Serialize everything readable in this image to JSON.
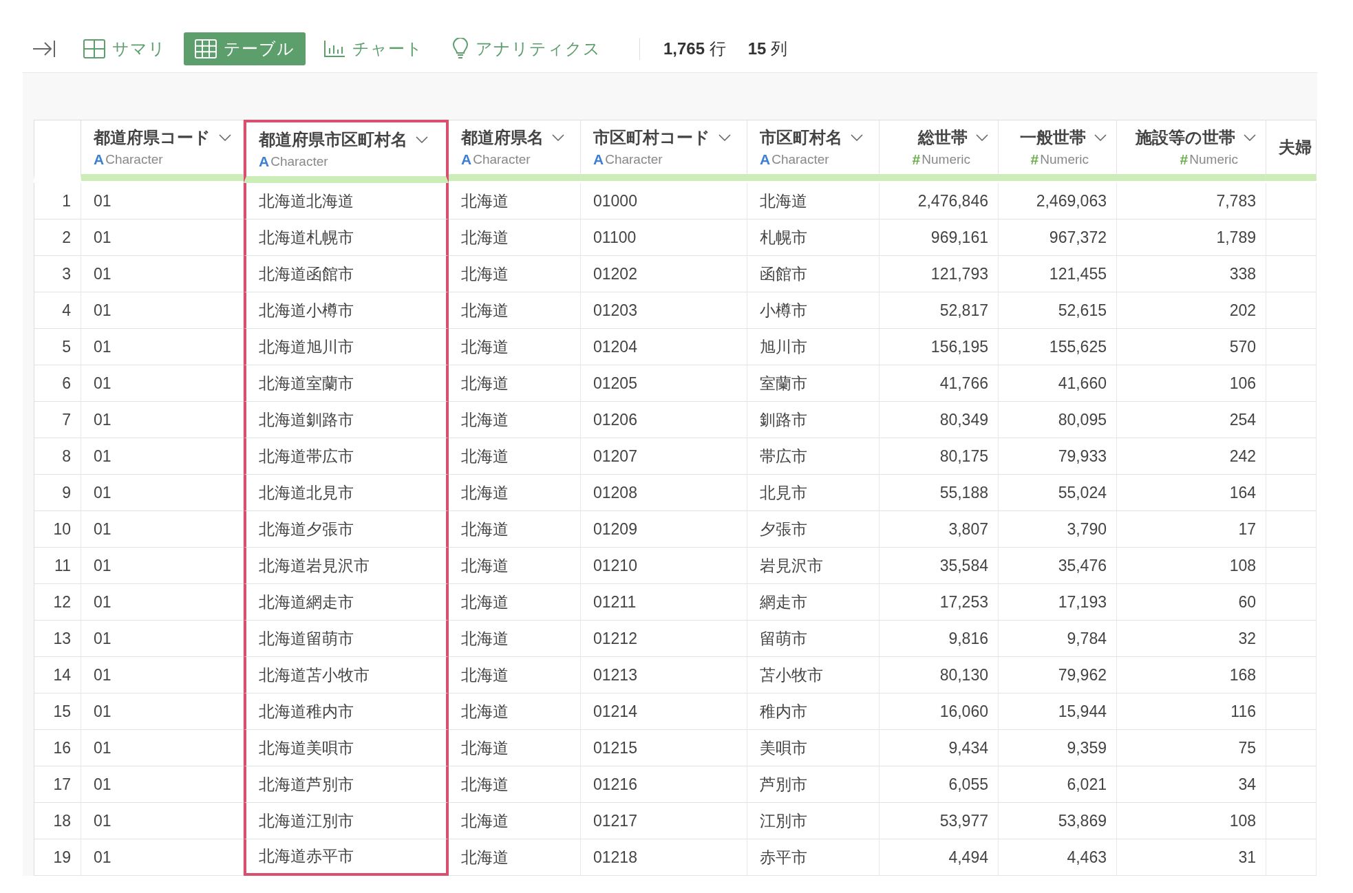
{
  "toolbar": {
    "tabs": [
      {
        "label": "サマリ",
        "selected": false
      },
      {
        "label": "テーブル",
        "selected": true
      },
      {
        "label": "チャート",
        "selected": false
      },
      {
        "label": "アナリティクス",
        "selected": false
      }
    ],
    "row_count": {
      "value": "1,765",
      "unit": "行"
    },
    "column_count": {
      "value": "15",
      "unit": "列"
    }
  },
  "table": {
    "columns": [
      {
        "name": "都道府県コード",
        "type_mark": "A",
        "type": "Character",
        "kind": "character",
        "selected": false
      },
      {
        "name": "都道府県市区町村名",
        "type_mark": "A",
        "type": "Character",
        "kind": "character",
        "selected": true
      },
      {
        "name": "都道府県名",
        "type_mark": "A",
        "type": "Character",
        "kind": "character",
        "selected": false
      },
      {
        "name": "市区町村コード",
        "type_mark": "A",
        "type": "Character",
        "kind": "character",
        "selected": false
      },
      {
        "name": "市区町村名",
        "type_mark": "A",
        "type": "Character",
        "kind": "character",
        "selected": false
      },
      {
        "name": "総世帯",
        "type_mark": "#",
        "type": "Numeric",
        "kind": "numeric",
        "selected": false
      },
      {
        "name": "一般世帯",
        "type_mark": "#",
        "type": "Numeric",
        "kind": "numeric",
        "selected": false
      },
      {
        "name": "施設等の世帯",
        "type_mark": "#",
        "type": "Numeric",
        "kind": "numeric",
        "selected": false
      },
      {
        "name": "夫婦",
        "kind": "cut",
        "selected": false
      }
    ],
    "rows": [
      {
        "number": "1",
        "cells": [
          "01",
          "北海道北海道",
          "北海道",
          "01000",
          "北海道",
          "2,476,846",
          "2,469,063",
          "7,783"
        ]
      },
      {
        "number": "2",
        "cells": [
          "01",
          "北海道札幌市",
          "北海道",
          "01100",
          "札幌市",
          "969,161",
          "967,372",
          "1,789"
        ]
      },
      {
        "number": "3",
        "cells": [
          "01",
          "北海道函館市",
          "北海道",
          "01202",
          "函館市",
          "121,793",
          "121,455",
          "338"
        ]
      },
      {
        "number": "4",
        "cells": [
          "01",
          "北海道小樽市",
          "北海道",
          "01203",
          "小樽市",
          "52,817",
          "52,615",
          "202"
        ]
      },
      {
        "number": "5",
        "cells": [
          "01",
          "北海道旭川市",
          "北海道",
          "01204",
          "旭川市",
          "156,195",
          "155,625",
          "570"
        ]
      },
      {
        "number": "6",
        "cells": [
          "01",
          "北海道室蘭市",
          "北海道",
          "01205",
          "室蘭市",
          "41,766",
          "41,660",
          "106"
        ]
      },
      {
        "number": "7",
        "cells": [
          "01",
          "北海道釧路市",
          "北海道",
          "01206",
          "釧路市",
          "80,349",
          "80,095",
          "254"
        ]
      },
      {
        "number": "8",
        "cells": [
          "01",
          "北海道帯広市",
          "北海道",
          "01207",
          "帯広市",
          "80,175",
          "79,933",
          "242"
        ]
      },
      {
        "number": "9",
        "cells": [
          "01",
          "北海道北見市",
          "北海道",
          "01208",
          "北見市",
          "55,188",
          "55,024",
          "164"
        ]
      },
      {
        "number": "10",
        "cells": [
          "01",
          "北海道夕張市",
          "北海道",
          "01209",
          "夕張市",
          "3,807",
          "3,790",
          "17"
        ]
      },
      {
        "number": "11",
        "cells": [
          "01",
          "北海道岩見沢市",
          "北海道",
          "01210",
          "岩見沢市",
          "35,584",
          "35,476",
          "108"
        ]
      },
      {
        "number": "12",
        "cells": [
          "01",
          "北海道網走市",
          "北海道",
          "01211",
          "網走市",
          "17,253",
          "17,193",
          "60"
        ]
      },
      {
        "number": "13",
        "cells": [
          "01",
          "北海道留萌市",
          "北海道",
          "01212",
          "留萌市",
          "9,816",
          "9,784",
          "32"
        ]
      },
      {
        "number": "14",
        "cells": [
          "01",
          "北海道苫小牧市",
          "北海道",
          "01213",
          "苫小牧市",
          "80,130",
          "79,962",
          "168"
        ]
      },
      {
        "number": "15",
        "cells": [
          "01",
          "北海道稚内市",
          "北海道",
          "01214",
          "稚内市",
          "16,060",
          "15,944",
          "116"
        ]
      },
      {
        "number": "16",
        "cells": [
          "01",
          "北海道美唄市",
          "北海道",
          "01215",
          "美唄市",
          "9,434",
          "9,359",
          "75"
        ]
      },
      {
        "number": "17",
        "cells": [
          "01",
          "北海道芦別市",
          "北海道",
          "01216",
          "芦別市",
          "6,055",
          "6,021",
          "34"
        ]
      },
      {
        "number": "18",
        "cells": [
          "01",
          "北海道江別市",
          "北海道",
          "01217",
          "江別市",
          "53,977",
          "53,869",
          "108"
        ]
      },
      {
        "number": "19",
        "cells": [
          "01",
          "北海道赤平市",
          "北海道",
          "01218",
          "赤平市",
          "4,494",
          "4,463",
          "31"
        ]
      }
    ]
  }
}
